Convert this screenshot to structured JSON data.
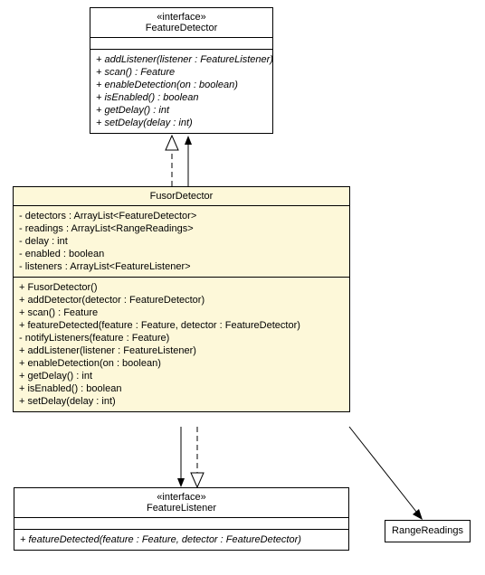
{
  "featureDetector": {
    "stereotype": "«interface»",
    "name": "FeatureDetector",
    "methods": [
      "+ addListener(listener : FeatureListener)",
      "+ scan() : Feature",
      "+ enableDetection(on : boolean)",
      "+ isEnabled() : boolean",
      "+ getDelay() : int",
      "+ setDelay(delay : int)"
    ]
  },
  "fusorDetector": {
    "name": "FusorDetector",
    "attributes": [
      "- detectors : ArrayList<FeatureDetector>",
      "- readings : ArrayList<RangeReadings>",
      "- delay : int",
      "- enabled : boolean",
      "- listeners : ArrayList<FeatureListener>"
    ],
    "methods": [
      "+ FusorDetector()",
      "+ addDetector(detector : FeatureDetector)",
      "+ scan() : Feature",
      "+ featureDetected(feature : Feature, detector : FeatureDetector)",
      "- notifyListeners(feature : Feature)",
      "+ addListener(listener : FeatureListener)",
      "+ enableDetection(on : boolean)",
      "+ getDelay() : int",
      "+ isEnabled() : boolean",
      "+ setDelay(delay : int)"
    ]
  },
  "featureListener": {
    "stereotype": "«interface»",
    "name": "FeatureListener",
    "methods": [
      "+ featureDetected(feature : Feature, detector : FeatureDetector)"
    ]
  },
  "rangeReadings": {
    "name": "RangeReadings"
  }
}
